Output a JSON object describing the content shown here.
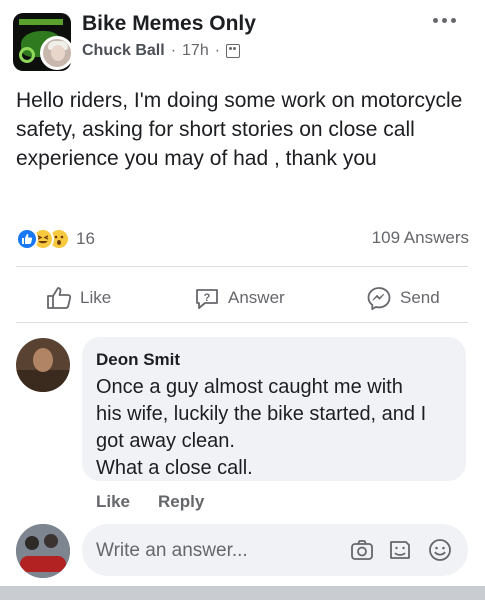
{
  "post": {
    "group_name": "Bike Memes Only",
    "author": "Chuck Ball",
    "time": "17h",
    "separator": "·",
    "text": "Hello riders, I'm doing some work on motorcycle safety, asking for short stories on close call experience you may of had , thank you"
  },
  "stats": {
    "reaction_count": "16",
    "answers": "109 Answers"
  },
  "actions": {
    "like": "Like",
    "answer": "Answer",
    "send": "Send"
  },
  "comment": {
    "author": "Deon Smit",
    "lines": [
      "Once a guy almost caught me with",
      "his wife, luckily the bike started, and I",
      "got away clean.",
      "What a close call."
    ],
    "like": "Like",
    "reply": "Reply"
  },
  "composer": {
    "placeholder": "Write an answer..."
  },
  "colors": {
    "like_blue": "#1877f2",
    "muted": "#65676b",
    "bubble": "#f0f2f5"
  },
  "icons": [
    "more-icon",
    "group-icon",
    "like-icon",
    "answer-icon",
    "messenger-icon",
    "camera-icon",
    "gif-icon",
    "emoji-icon"
  ]
}
